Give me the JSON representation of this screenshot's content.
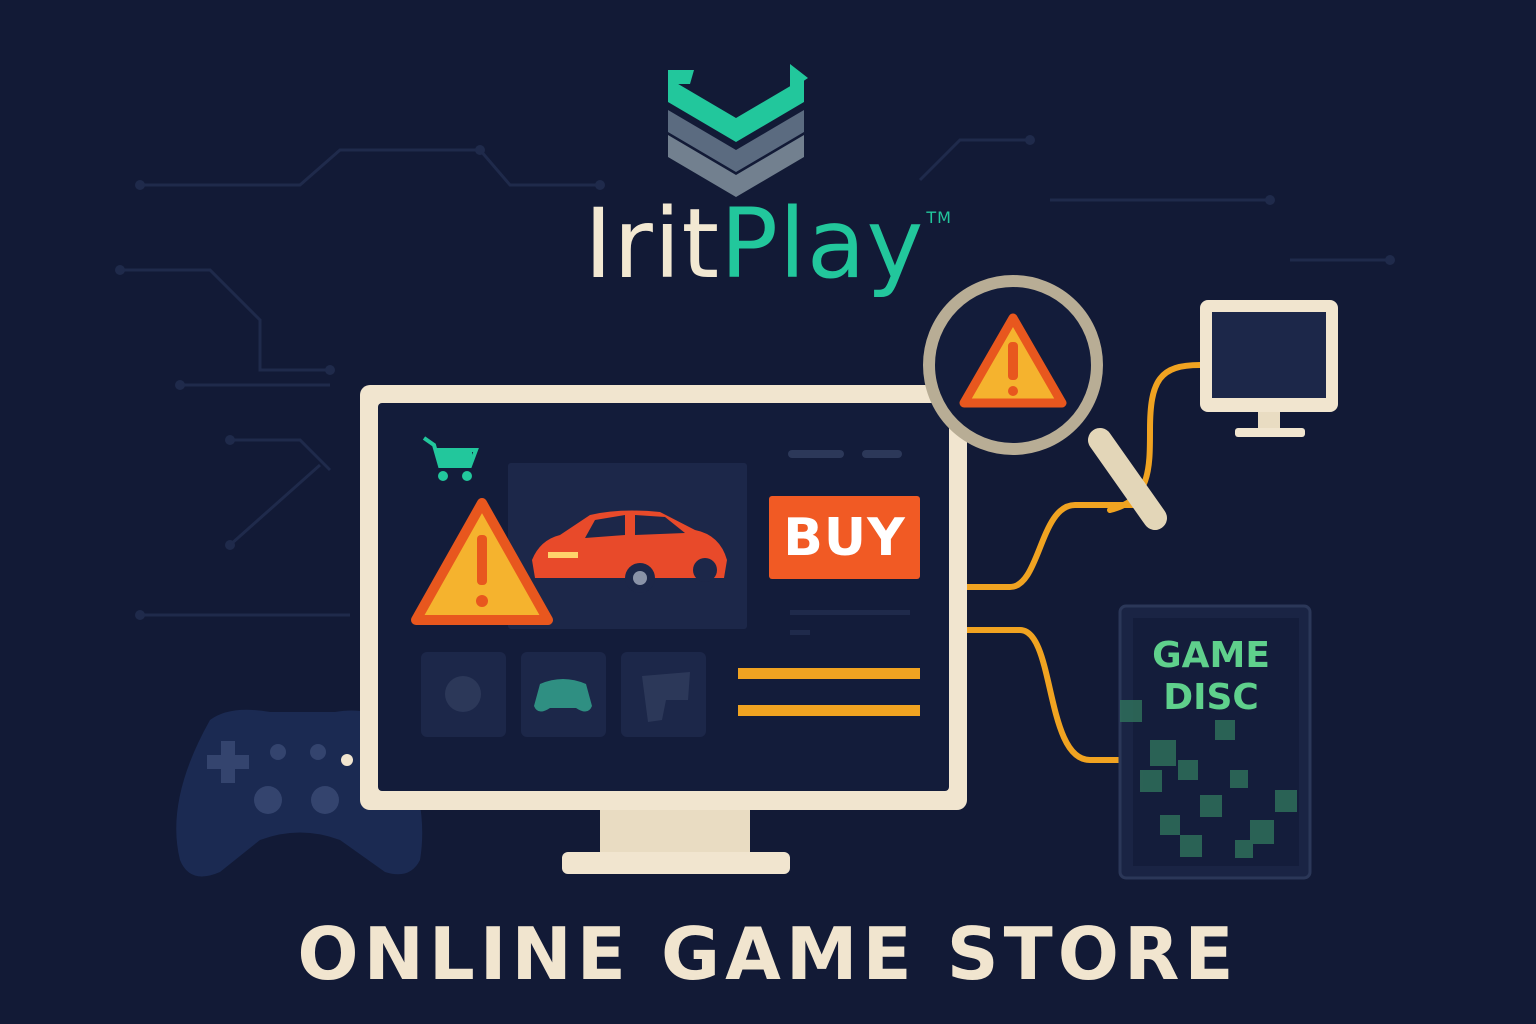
{
  "brand": {
    "name_part1": "Irit",
    "name_part2": "Play",
    "trademark": "TM"
  },
  "store_screen": {
    "buy_label": "BUY"
  },
  "game_disc": {
    "line1": "GAME",
    "line2": "DISC"
  },
  "footer": {
    "title": "ONLINE GAME STORE"
  },
  "colors": {
    "background": "#121a36",
    "cream": "#f1e5cf",
    "teal": "#22c79c",
    "orange": "#f15a24",
    "warning_yellow": "#f5b32e",
    "cable_orange": "#f0a321",
    "disc_green": "#5fd08c"
  },
  "icons": [
    "logo-chevrons",
    "cart-icon",
    "warning-icon",
    "magnifier-icon",
    "monitor-icon",
    "gamepad-icon",
    "car-image"
  ]
}
